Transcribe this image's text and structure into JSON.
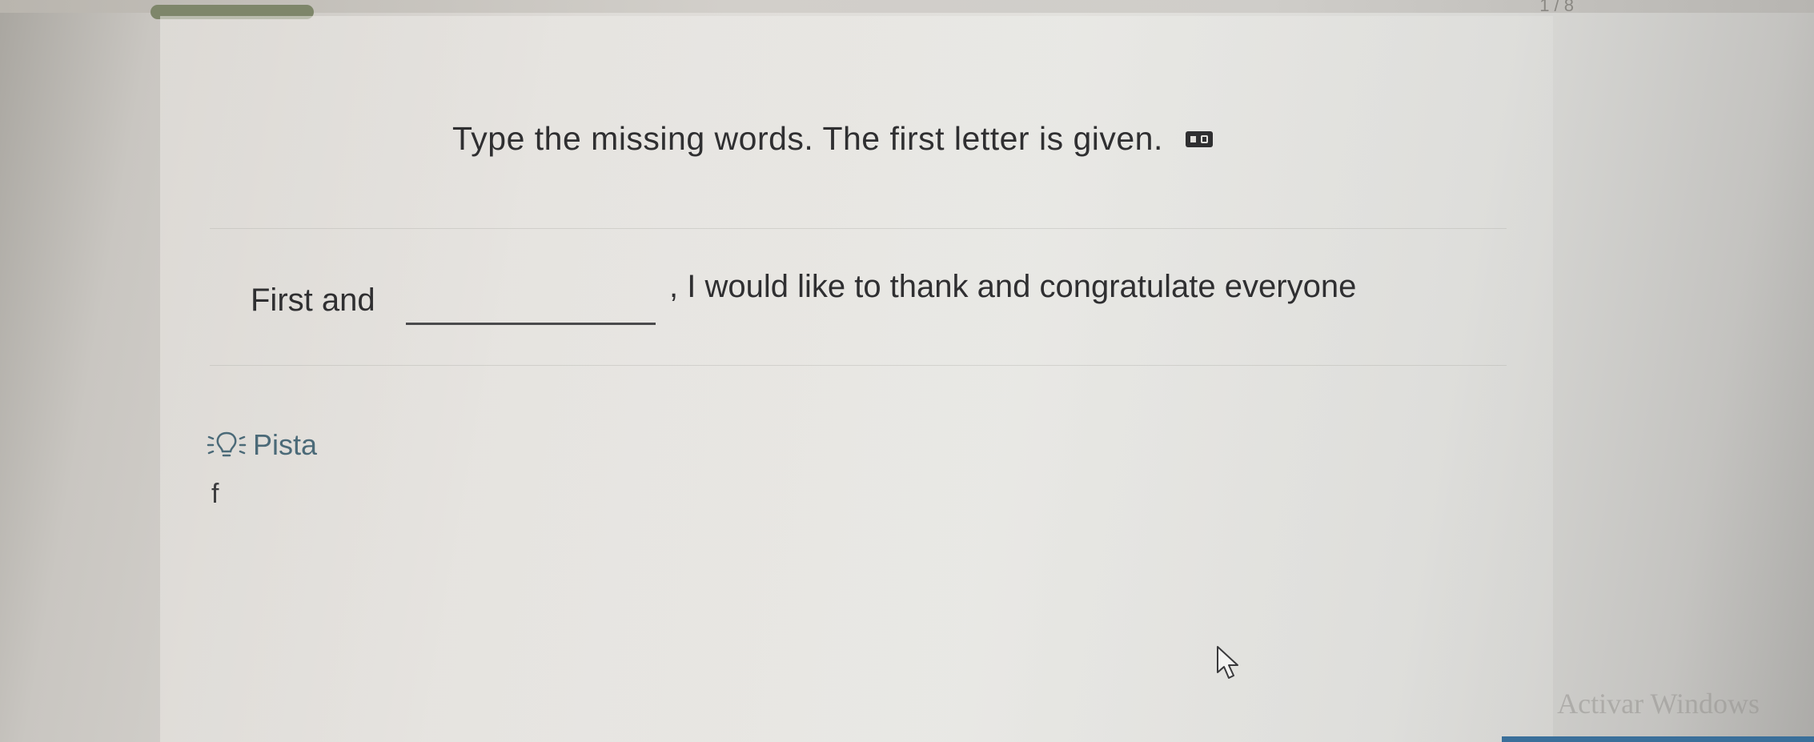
{
  "progress": {
    "fraction": 0.09,
    "counter_text": "1 / 8"
  },
  "exercise": {
    "instruction": "Type the missing words. The first letter is given.",
    "audio_icon": "audio-translate-icon",
    "sentence_before": "First and",
    "answer_value": "",
    "answer_placeholder": "",
    "sentence_after": ", I would like to thank and congratulate everyone"
  },
  "hint": {
    "icon": "lightbulb-icon",
    "label": "Pista",
    "text": "f"
  },
  "overlay": {
    "watermark": "Activar Windows",
    "cursor_icon": "mouse-pointer-icon"
  },
  "colors": {
    "text": "#2f2f31",
    "hint_link": "#4b6a78",
    "progress_fill": "#7e866a"
  }
}
